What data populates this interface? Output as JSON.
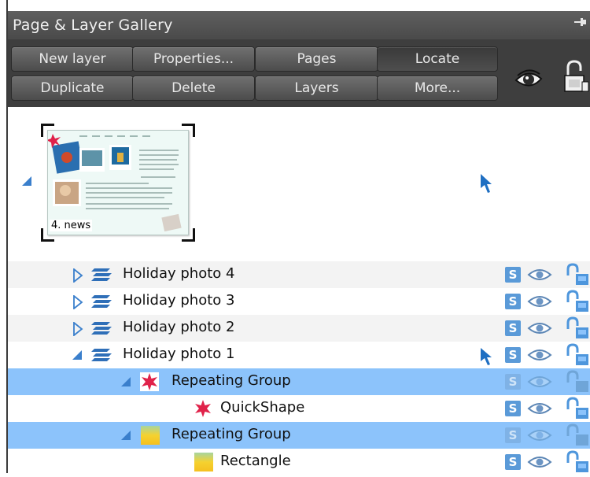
{
  "panel": {
    "title": "Page & Layer Gallery",
    "pin_glyph": "⊣"
  },
  "toolbar": {
    "row1": [
      "New layer",
      "Properties...",
      "Pages",
      "Locate"
    ],
    "row2": [
      "Duplicate",
      "Delete",
      "Layers",
      "More..."
    ],
    "active": "Locate",
    "show_icon": "eye-show-all-icon",
    "lock_icon": "lock-all-icon"
  },
  "page": {
    "label": "4. news",
    "expanded": true
  },
  "layers": [
    {
      "label": "Holiday photo 4",
      "type": "layer",
      "expanded": false,
      "level": 1,
      "selected": false
    },
    {
      "label": "Holiday photo 3",
      "type": "layer",
      "expanded": false,
      "level": 1,
      "selected": false
    },
    {
      "label": "Holiday photo 2",
      "type": "layer",
      "expanded": false,
      "level": 1,
      "selected": false
    },
    {
      "label": "Holiday photo 1",
      "type": "layer",
      "expanded": true,
      "level": 1,
      "selected": false,
      "pointer": true
    },
    {
      "label": "Repeating Group",
      "type": "group-star",
      "expanded": true,
      "level": 2,
      "selected": true
    },
    {
      "label": "QuickShape",
      "type": "star",
      "level": 3,
      "selected": false
    },
    {
      "label": "Repeating Group",
      "type": "group-rect",
      "expanded": true,
      "level": 2,
      "selected": true
    },
    {
      "label": "Rectangle",
      "type": "rect",
      "level": 3,
      "selected": false
    }
  ],
  "colors": {
    "accent": "#3a7fcc",
    "selection": "#8cc3fb",
    "star": "#e0224a",
    "rect_fill": "#f5d230"
  }
}
